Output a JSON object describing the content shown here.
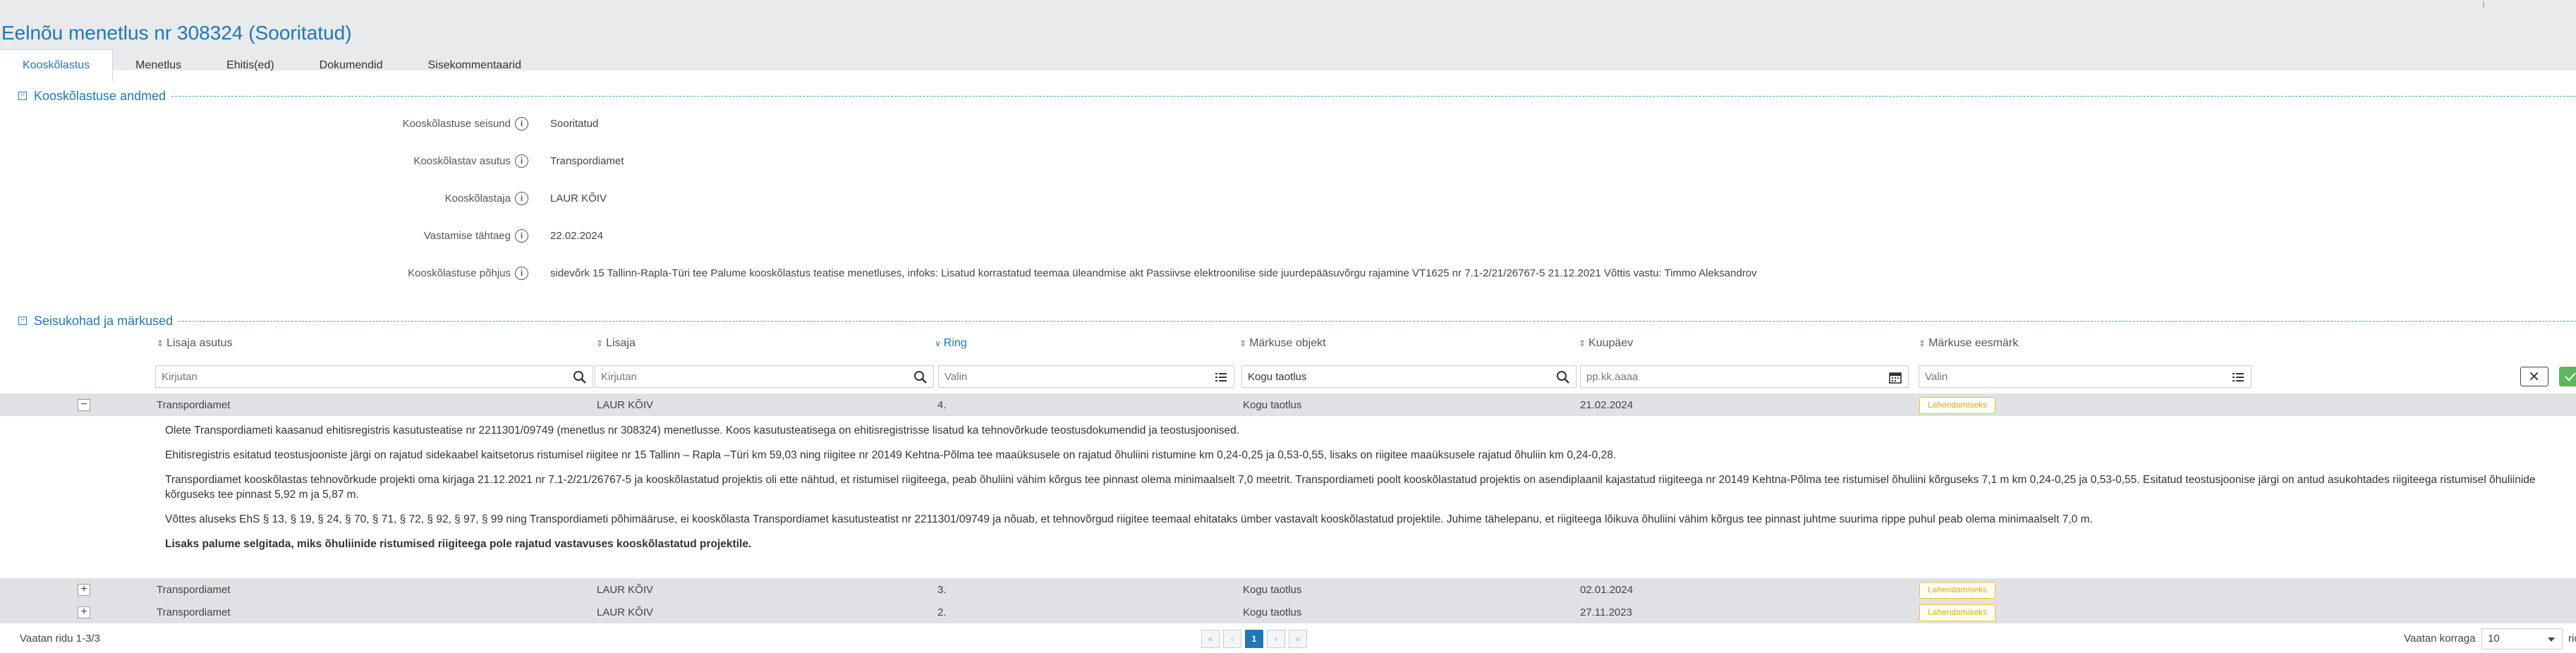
{
  "page": {
    "title": "Eelnõu menetlus nr 308324 (Sooritatud)",
    "tabs": [
      "Kooskõlastus",
      "Menetlus",
      "Ehitis(ed)",
      "Dokumendid",
      "Sisekommentaarid"
    ],
    "active_tab": "Kooskõlastus"
  },
  "agreement": {
    "section_title": "Kooskõlastuse andmed",
    "fields": [
      {
        "label": "Kooskõlastuse seisund",
        "value": "Sooritatud"
      },
      {
        "label": "Kooskõlastav asutus",
        "value": "Transpordiamet"
      },
      {
        "label": "Kooskõlastaja",
        "value": "LAUR KÕIV"
      },
      {
        "label": "Vastamise tähtaeg",
        "value": "22.02.2024"
      },
      {
        "label": "Kooskõlastuse põhjus",
        "value": "sidevõrk 15 Tallinn-Rapla-Türi tee Palume kooskõlastus teatise menetluses, infoks: Lisatud korrastatud teemaa üleandmise akt Passiivse elektroonilise side juurdepääsuvõrgu rajamine VT1625 nr 7.1-2/21/26767-5 21.12.2021 Võttis vastu: Timmo Aleksandrov"
      }
    ]
  },
  "positions": {
    "section_title": "Seisukohad ja märkused",
    "columns": [
      "Lisaja asutus",
      "Lisaja",
      "Ring",
      "Märkuse objekt",
      "Kuupäev",
      "Märkuse eesmärk"
    ],
    "active_column": "Ring",
    "filters": {
      "agency_placeholder": "Kirjutan",
      "adder_placeholder": "Kirjutan",
      "round_placeholder": "Valin",
      "object_value": "Kogu taotlus",
      "date_placeholder": "pp.kk.aaaa",
      "purpose_placeholder": "Valin"
    },
    "rows": [
      {
        "agency": "Transpordiamet",
        "adder": "LAUR KÕIV",
        "round": "4.",
        "object": "Kogu taotlus",
        "date": "21.02.2024",
        "purpose": "Lahendamiseks",
        "expanded": true
      },
      {
        "agency": "Transpordiamet",
        "adder": "LAUR KÕIV",
        "round": "3.",
        "object": "Kogu taotlus",
        "date": "02.01.2024",
        "purpose": "Lahendamiseks",
        "expanded": false
      },
      {
        "agency": "Transpordiamet",
        "adder": "LAUR KÕIV",
        "round": "2.",
        "object": "Kogu taotlus",
        "date": "27.11.2023",
        "purpose": "Lahendamiseks",
        "expanded": false
      }
    ],
    "detail_paragraphs": [
      "Olete Transpordiameti kaasanud ehitisregistris kasutusteatise nr 2211301/09749 (menetlus nr 308324) menetlusse. Koos kasutusteatisega on ehitisregistrisse lisatud ka tehnovõrkude teostusdokumendid ja teostusjoonised.",
      "Ehitisregistris esitatud teostusjooniste järgi on rajatud sidekaabel kaitsetorus ristumisel riigitee nr 15 Tallinn – Rapla –Türi km 59,03 ning riigitee nr 20149 Kehtna-Põlma tee maaüksusele on rajatud õhuliini ristumine km 0,24-0,25 ja 0,53-0,55, lisaks on riigitee maaüksusele rajatud õhuliin km 0,24-0,28.",
      "Transpordiamet kooskõlastas tehnovõrkude projekti oma kirjaga 21.12.2021 nr 7.1-2/21/26767-5 ja kooskõlastatud projektis oli ette nähtud, et ristumisel riigiteega, peab õhuliini vähim kõrgus tee pinnast olema minimaalselt 7,0 meetrit. Transpordiameti poolt kooskõlastatud projektis on asendiplaanil kajastatud riigiteega nr 20149 Kehtna-Põlma tee ristumisel õhuliini kõrguseks 7,1 m km 0,24-0,25 ja 0,53-0,55. Esitatud teostusjoonise järgi on antud asukohtades riigiteega ristumisel õhuliinide kõrguseks tee pinnast 5,92 m ja 5,87 m.",
      "Võttes aluseks EhS § 13, § 19, § 24, § 70, § 71, § 72, § 92, § 97, § 99 ning Transpordiameti põhimääruse, ei kooskõlasta Transpordiamet kasutusteatist nr 2211301/09749 ja nõuab, et tehnovõrgud riigitee teemaal ehitataks ümber vastavalt kooskõlastatud projektile. Juhime tähelepanu, et riigiteega lõikuva õhuliini vähim kõrgus tee pinnast juhtme suurima rippe puhul peab olema minimaalselt 7,0 m.",
      "Lisaks palume selgitada, miks õhuliinide ristumised riigiteega pole rajatud vastavuses kooskõlastatud projektile."
    ]
  },
  "footer": {
    "rows_info": "Vaatan ridu 1-3/3",
    "current_page": "1",
    "per_page_label": "Vaatan korraga",
    "per_page_value": "10",
    "tail": "ric"
  },
  "icons": {
    "search": "search-icon",
    "list": "list-icon",
    "calendar": "calendar-icon",
    "info": "info-icon"
  },
  "colors": {
    "accent": "#1f78b4",
    "badge": "#f0c419",
    "section_line": "#3fb08a",
    "apply": "#5cb85c"
  }
}
